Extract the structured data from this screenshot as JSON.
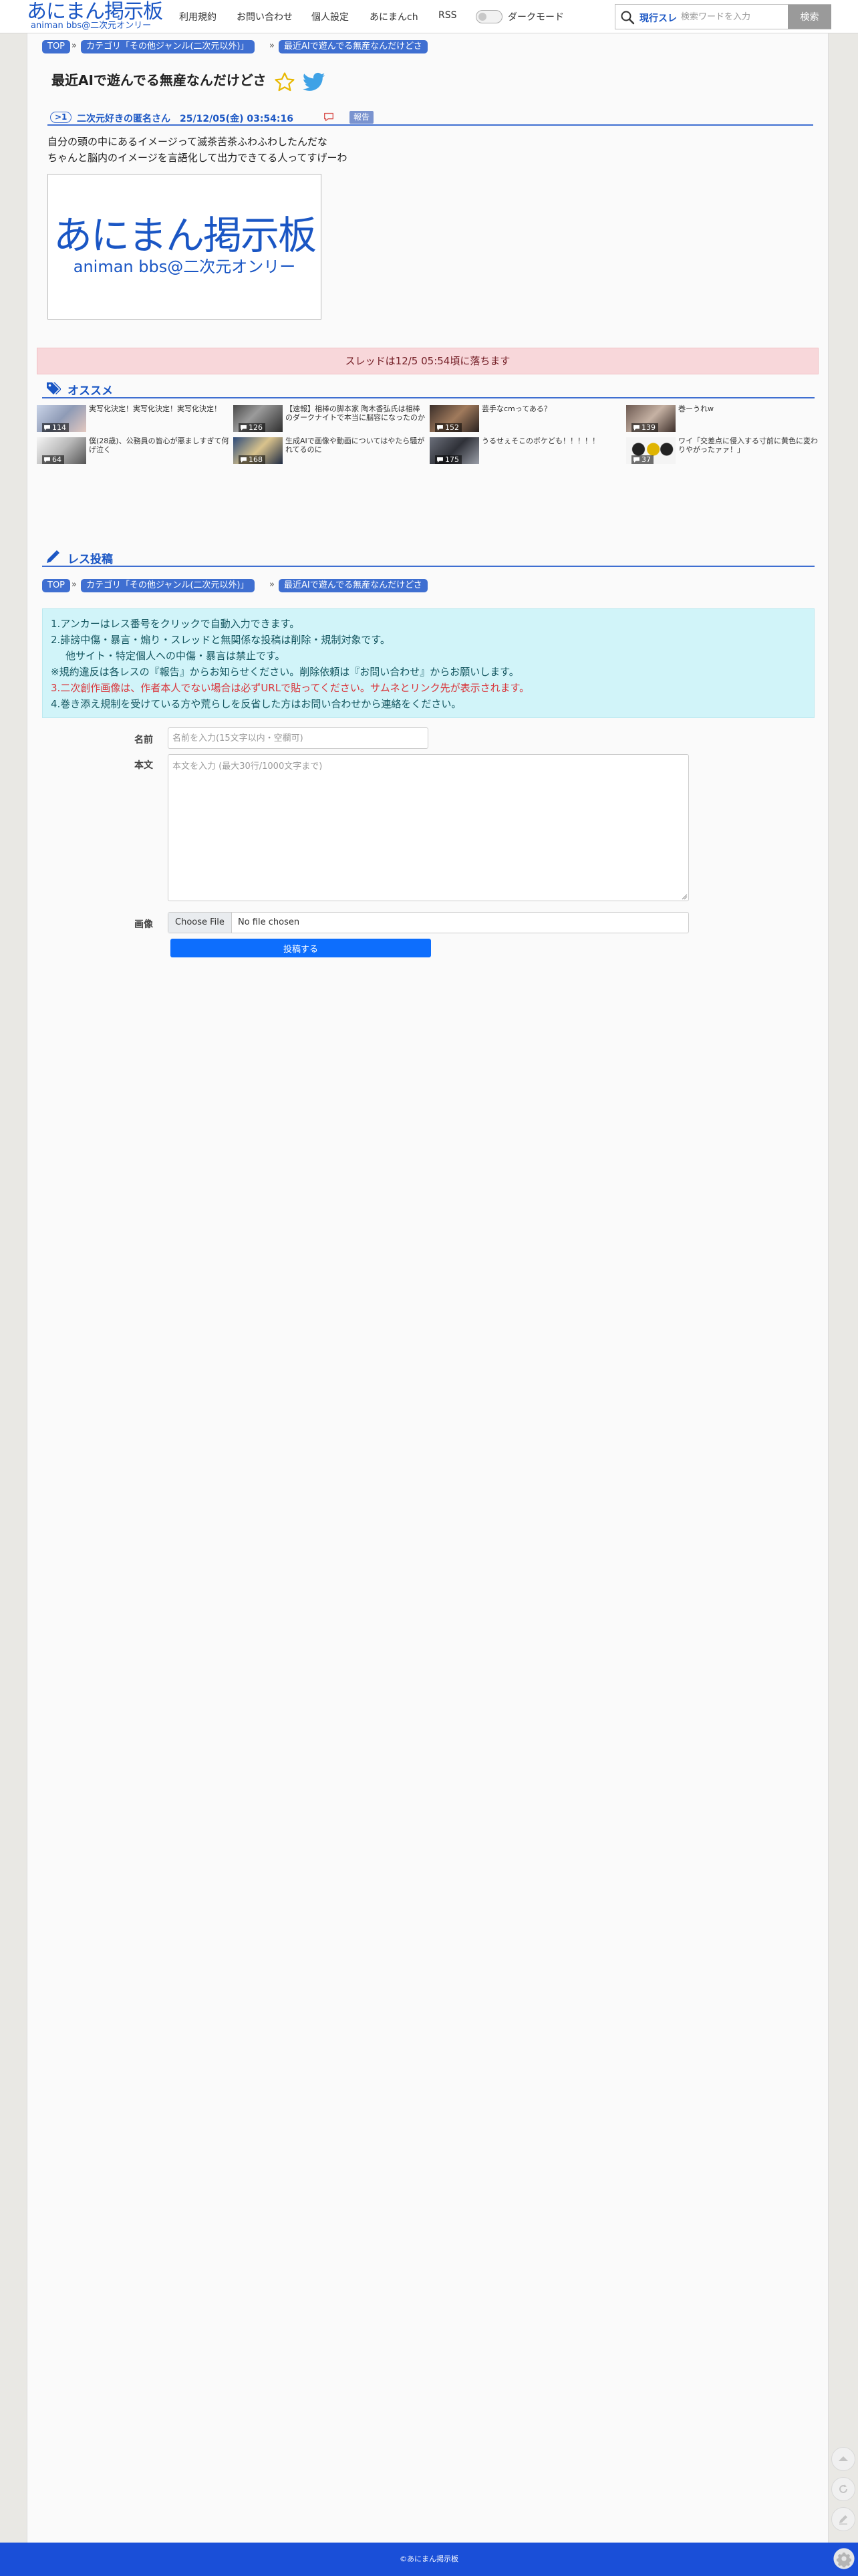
{
  "header": {
    "logo_main": "あにまん掲示板",
    "logo_sub": "animan bbs@二次元オンリー",
    "nav": [
      "利用規約",
      "お問い合わせ",
      "個人設定",
      "あにまんch",
      "RSS"
    ],
    "darkmode_label": "ダークモード",
    "search_scope": "現行スレ",
    "search_placeholder": "検索ワードを入力",
    "search_button": "検索"
  },
  "breadcrumb": {
    "top": "TOP",
    "category": "カテゴリ「その他ジャンル(二次元以外)」",
    "thread": "最近AIで遊んでる無産なんだけどさ"
  },
  "thread": {
    "title": "最近AIで遊んでる無産なんだけどさ",
    "post": {
      "number": ">1",
      "author_line": "二次元好きの匿名さん　25/12/05(金) 03:54:16",
      "report": "報告",
      "body_lines": [
        "自分の頭の中にあるイメージって滅茶苦茶ふわふわしたんだな",
        "ちゃんと脳内のイメージを言語化して出力できてる人ってすげーわ"
      ],
      "image_main": "あにまん掲示板",
      "image_sub": "animan bbs@二次元オンリー"
    },
    "notice": "スレッドは12/5 05:54頃に落ちます"
  },
  "recommend": {
    "title": "オススメ",
    "items": [
      {
        "title": "実写化決定！実写化決定！実写化決定！",
        "count": "114"
      },
      {
        "title": "【速報】相棒の脚本家 陶木香弘氏は相棒のダークナイトで本当に脳容になったのか",
        "count": "126"
      },
      {
        "title": "芸手なcmってある？",
        "count": "152"
      },
      {
        "title": "巻ーうれw",
        "count": "139"
      },
      {
        "title": "僕(28歳)、公務員の皆心が悪ましすぎて何げ泣く",
        "count": "64"
      },
      {
        "title": "生成AIで画像や動画についてはやたら騒がれてるのに",
        "count": "168"
      },
      {
        "title": "うるせぇそこのボケども！！！！！",
        "count": "175"
      },
      {
        "title": "ワイ「交差点に侵入する寸前に黄色に変わりやがったァァ！」",
        "count": "37"
      }
    ]
  },
  "reply": {
    "title": "レス投稿",
    "rules": [
      "1.アンカーはレス番号をクリックで自動入力できます。",
      "2.誹謗中傷・暴言・煽り・スレッドと無関係な投稿は削除・規制対象です。",
      "他サイト・特定個人への中傷・暴言は禁止です。",
      "※規約違反は各レスの『報告』からお知らせください。削除依頼は『お問い合わせ』からお願いします。",
      "3.二次創作画像は、作者本人でない場合は必ずURLで貼ってください。サムネとリンク先が表示されます。",
      "4.巻き添え規制を受けている方や荒らしを反省した方はお問い合わせから連絡をください。"
    ],
    "form": {
      "name_label": "名前",
      "name_placeholder": "名前を入力(15文字以内・空欄可)",
      "body_label": "本文",
      "body_placeholder": "本文を入力 (最大30行/1000文字まで)",
      "image_label": "画像",
      "file_button": "Choose File",
      "file_status": "No file chosen",
      "submit": "投稿する"
    }
  },
  "footer": {
    "copyright": "©あにまん掲示板"
  },
  "colors": {
    "brand_blue": "#1a56c4",
    "crumb_blue": "#3f6fd1",
    "footer_blue": "#1a4fd8",
    "notice_bg": "#f8d7da",
    "rules_bg": "#d1f4f9",
    "submit_blue": "#0d6efd"
  }
}
